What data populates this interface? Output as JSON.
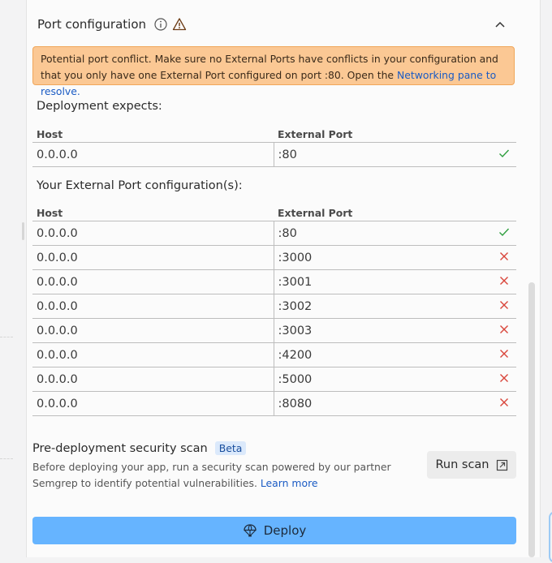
{
  "header": {
    "title": "Port configuration",
    "info_icon": "info-circle-icon",
    "warning_icon": "warning-triangle-icon",
    "collapse_icon": "chevron-up-icon"
  },
  "alert": {
    "text": "Potential port conflict. Make sure no External Ports have conflicts in your configuration and that you only have one External Port configured on port :80. Open the ",
    "link": "Networking pane to resolve."
  },
  "expected": {
    "label": "Deployment expects:",
    "columns": {
      "host": "Host",
      "port": "External Port"
    },
    "rows": [
      {
        "host": "0.0.0.0",
        "port": ":80",
        "status": "ok"
      }
    ]
  },
  "configured": {
    "label": "Your External Port configuration(s):",
    "columns": {
      "host": "Host",
      "port": "External Port"
    },
    "rows": [
      {
        "host": "0.0.0.0",
        "port": ":80",
        "status": "ok"
      },
      {
        "host": "0.0.0.0",
        "port": ":3000",
        "status": "error"
      },
      {
        "host": "0.0.0.0",
        "port": ":3001",
        "status": "error"
      },
      {
        "host": "0.0.0.0",
        "port": ":3002",
        "status": "error"
      },
      {
        "host": "0.0.0.0",
        "port": ":3003",
        "status": "error"
      },
      {
        "host": "0.0.0.0",
        "port": ":4200",
        "status": "error"
      },
      {
        "host": "0.0.0.0",
        "port": ":5000",
        "status": "error"
      },
      {
        "host": "0.0.0.0",
        "port": ":8080",
        "status": "error"
      }
    ]
  },
  "security_scan": {
    "title": "Pre-deployment security scan",
    "badge": "Beta",
    "description": "Before deploying your app, run a security scan powered by our partner Semgrep to identify potential vulnerabilities. ",
    "learn_more": "Learn more",
    "run_label": "Run scan",
    "run_icon": "external-link-icon"
  },
  "deploy": {
    "label": "Deploy",
    "icon": "deploy-icon"
  },
  "colors": {
    "ok": "#2e9e3e",
    "error": "#d9453a",
    "alert_bg": "#fbc894",
    "deploy_bg": "#66b4ff"
  }
}
